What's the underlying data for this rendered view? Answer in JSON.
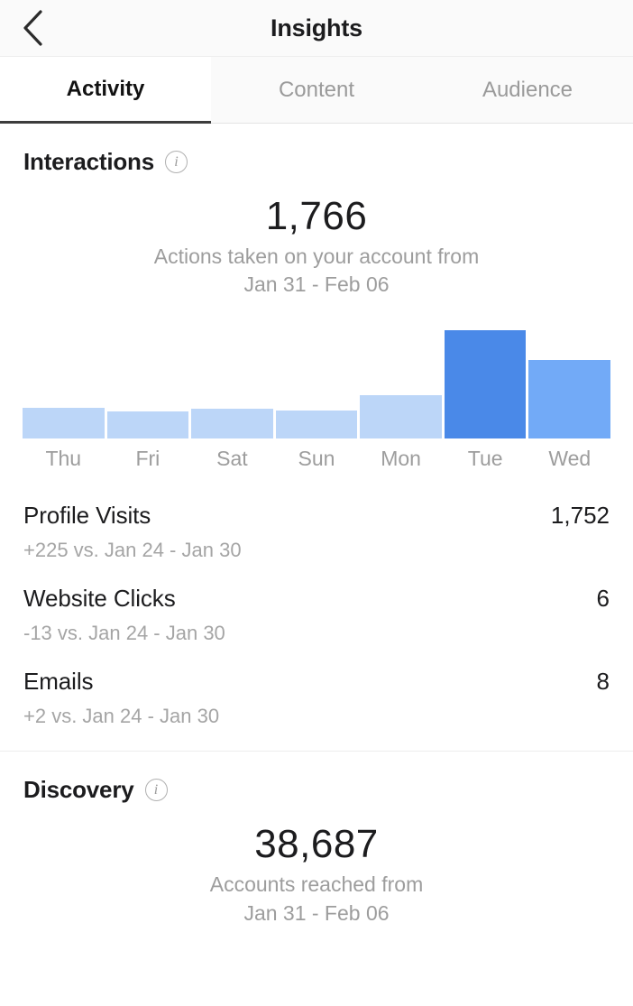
{
  "header": {
    "title": "Insights",
    "back_icon": "chevron-left-icon"
  },
  "tabs": [
    {
      "label": "Activity",
      "active": true
    },
    {
      "label": "Content",
      "active": false
    },
    {
      "label": "Audience",
      "active": false
    }
  ],
  "interactions": {
    "title": "Interactions",
    "info_icon": "info-circle-icon",
    "value": "1,766",
    "caption_line1": "Actions taken on your account from",
    "caption_line2": "Jan 31 - Feb 06",
    "metrics": [
      {
        "name": "Profile Visits",
        "value": "1,752",
        "comparison": "+225 vs. Jan 24 - Jan 30"
      },
      {
        "name": "Website Clicks",
        "value": "6",
        "comparison": "-13 vs. Jan 24 - Jan 30"
      },
      {
        "name": "Emails",
        "value": "8",
        "comparison": "+2 vs. Jan 24 - Jan 30"
      }
    ]
  },
  "discovery": {
    "title": "Discovery",
    "info_icon": "info-circle-icon",
    "value": "38,687",
    "caption_line1": "Accounts reached from",
    "caption_line2": "Jan 31 - Feb 06"
  },
  "colors": {
    "bar_light": "#bcd6f8",
    "bar_medium": "#72aaf7",
    "bar_dark": "#4a89e8",
    "text_primary": "#1c1c1e",
    "text_muted": "#9d9d9d",
    "tab_active_underline": "#3c3c3c"
  },
  "chart_data": {
    "type": "bar",
    "title": "Interactions by day",
    "categories": [
      "Thu",
      "Fri",
      "Sat",
      "Sun",
      "Mon",
      "Tue",
      "Wed"
    ],
    "values": [
      180,
      158,
      170,
      168,
      252,
      628,
      460
    ],
    "bar_shades": [
      "light",
      "light",
      "light",
      "light",
      "light",
      "dark",
      "medium"
    ],
    "xlabel": "",
    "ylabel": "",
    "ylim": [
      0,
      660
    ],
    "grid": false,
    "legend": "none"
  }
}
